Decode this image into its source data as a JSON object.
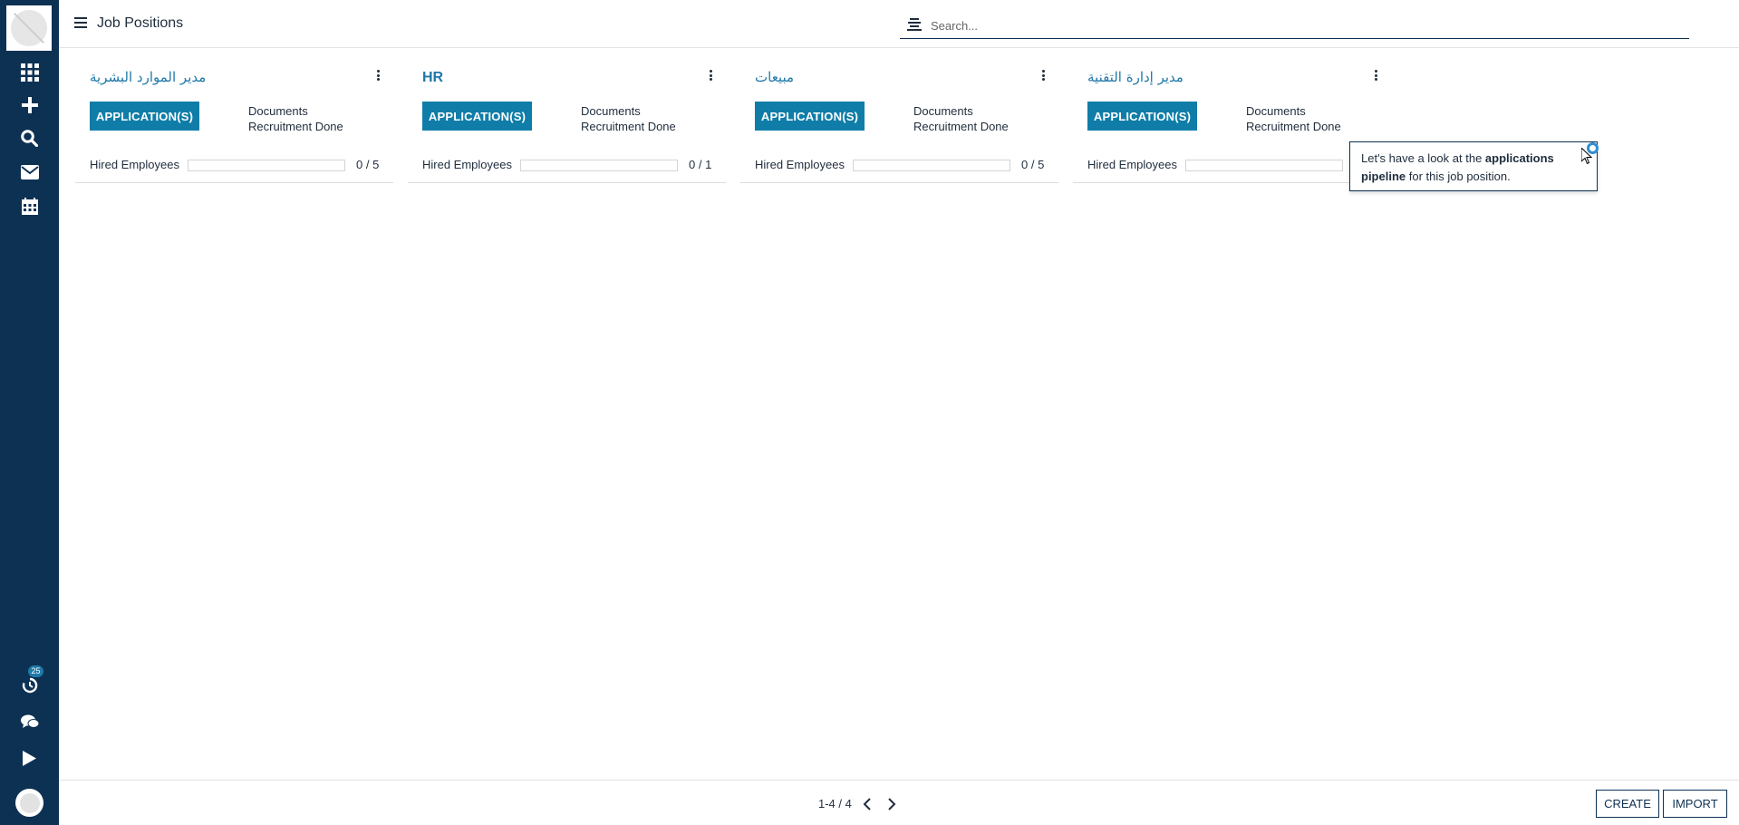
{
  "app": {
    "page_title": "Job Positions"
  },
  "search": {
    "placeholder": "Search..."
  },
  "sidebar": {
    "items": [
      {
        "name": "apps-grid-icon"
      },
      {
        "name": "plus-icon"
      },
      {
        "name": "search-icon"
      },
      {
        "name": "mail-icon"
      },
      {
        "name": "calendar-icon"
      }
    ],
    "activity_badge": "25"
  },
  "cards": [
    {
      "title": "مدير الموارد البشرية",
      "button": "APPLICATION(S)",
      "link1": "Documents",
      "link2": "Recruitment Done",
      "hired_label": "Hired Employees",
      "hired": 0,
      "target": 5,
      "hired_text": "0 / 5"
    },
    {
      "title": "HR",
      "button": "APPLICATION(S)",
      "link1": "Documents",
      "link2": "Recruitment Done",
      "hired_label": "Hired Employees",
      "hired": 0,
      "target": 1,
      "hired_text": "0 / 1"
    },
    {
      "title": "مبيعات",
      "button": "APPLICATION(S)",
      "link1": "Documents",
      "link2": "Recruitment Done",
      "hired_label": "Hired Employees",
      "hired": 0,
      "target": 5,
      "hired_text": "0 / 5"
    },
    {
      "title": "مدير إدارة التقنية",
      "button": "APPLICATION(S)",
      "link1": "Documents",
      "link2": "Recruitment Done",
      "hired_label": "Hired Employees",
      "hired": 0,
      "target": null,
      "hired_text": ""
    }
  ],
  "tooltip": {
    "prefix": "Let's have a look at the ",
    "bold": "applications pipeline",
    "suffix": " for this job position."
  },
  "pager": {
    "text": "1-4 / 4"
  },
  "actions": {
    "create": "CREATE",
    "import": "IMPORT"
  },
  "colors": {
    "sidebar": "#0d3153",
    "accent": "#0f7da8",
    "link": "#1f78a8"
  }
}
